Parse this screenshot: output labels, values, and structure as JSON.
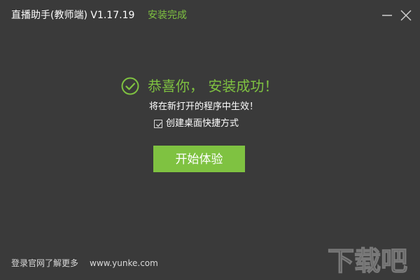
{
  "titlebar": {
    "app_title": "直播助手(教师端) V1.17.19",
    "status": "安装完成",
    "minimize_icon": "minimize-icon",
    "close_icon": "close-icon"
  },
  "main": {
    "success_icon": "check-circle-icon",
    "success_message": "恭喜你， 安装成功！",
    "restart_note": "将在新打开的程序中生效！",
    "shortcut_checkbox_checked": true,
    "shortcut_label": "创建桌面快捷方式",
    "start_button_label": "开始体验"
  },
  "footer": {
    "official_site_link": "登录官网了解更多",
    "url": "www.yunke.com"
  },
  "watermark": {
    "text": "下载吧"
  },
  "colors": {
    "background": "#3a3a3a",
    "accent": "#7fc241",
    "text": "#ffffff"
  }
}
